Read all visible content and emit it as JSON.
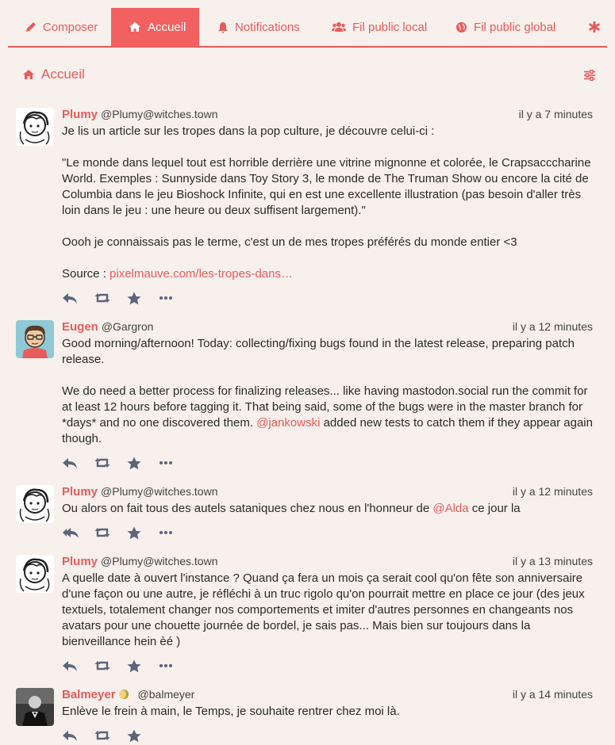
{
  "tabs": [
    {
      "label": "Composer",
      "icon": "pencil-icon"
    },
    {
      "label": "Accueil",
      "icon": "home-icon",
      "active": true
    },
    {
      "label": "Notifications",
      "icon": "bell-icon"
    },
    {
      "label": "Fil public local",
      "icon": "users-icon"
    },
    {
      "label": "Fil public global",
      "icon": "globe-icon"
    },
    {
      "label": "",
      "icon": "asterisk-icon"
    }
  ],
  "column": {
    "title": "Accueil",
    "settings_icon": "sliders-icon"
  },
  "colors": {
    "accent": "#e85c5c",
    "background": "#f7f0ec",
    "icon": "#5c6579"
  },
  "statuses": [
    {
      "display_name": "Plumy",
      "acct": "@Plumy@witches.town",
      "time": "il y a 7 minutes",
      "p1": "Je lis un article sur les tropes dans la pop culture, je découvre celui-ci :",
      "p2": "\"Le monde dans lequel tout est horrible derrière une vitrine mignonne et colorée, le Crapsacccharine World. Exemples : Sunnyside dans Toy Story 3, le monde de The Truman Show ou encore la cité de Columbia dans le jeu Bioshock Infinite, qui en est une excellente illustration (pas besoin d'aller très loin dans le jeu : une heure ou deux suffisent largement).\"",
      "p3": "Oooh je connaissais pas le terme, c'est un de mes tropes préférés du monde entier <3",
      "p4_prefix": "Source : ",
      "p4_link": "pixelmauve.com/les-tropes-dans…"
    },
    {
      "display_name": "Eugen",
      "acct": "@Gargron",
      "time": "il y a 12 minutes",
      "p1": "Good morning/afternoon! Today: collecting/fixing bugs found in the latest release, preparing patch release.",
      "p2_before": "We do need a better process for finalizing releases... like having mastodon.social run the commit for at least 12 hours before tagging it. That being said, some of the bugs were in the master branch for *days* and no one discovered them. ",
      "p2_mention": "@jankowski",
      "p2_after": " added new tests to catch them if they appear again though."
    },
    {
      "display_name": "Plumy",
      "acct": "@Plumy@witches.town",
      "time": "il y a 12 minutes",
      "p1_before": "Ou alors on fait tous des autels sataniques chez nous en l'honneur de ",
      "p1_mention": "@Alda",
      "p1_after": " ce jour la"
    },
    {
      "display_name": "Plumy",
      "acct": "@Plumy@witches.town",
      "time": "il y a 13 minutes",
      "p1": "A quelle date à ouvert l'instance ? Quand ça fera un mois ça serait cool qu'on fête son anniversaire d'une façon ou une autre, je réfléchi à un truc rigolo qu'on pourrait mettre en place ce jour (des jeux textuels, totalement changer nos comportements et imiter d'autres personnes en changeants nos avatars pour une chouette journée de bordel, je sais pas... Mais bien sur toujours dans la bienveillance hein èé )"
    },
    {
      "display_name": "Balmeyer",
      "acct": "@balmeyer",
      "time": "il y a 14 minutes",
      "p1": "Enlève le frein à main, le Temps, je souhaite rentrer chez moi là."
    }
  ],
  "action_icons": [
    "reply-icon",
    "boost-icon",
    "favourite-icon",
    "more-icon"
  ]
}
